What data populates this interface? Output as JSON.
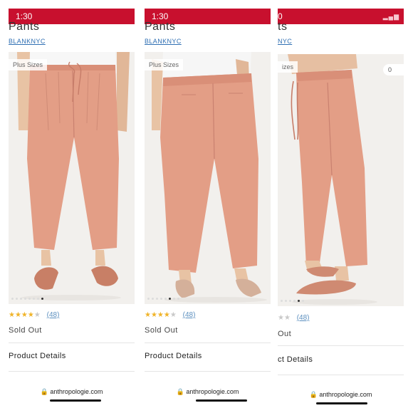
{
  "status_bar": {
    "time": "1:30",
    "time_partial": "0"
  },
  "product": {
    "title": "Pants",
    "title_partial": "ts",
    "brand": "BLANKNYC",
    "brand_partial": "NYC",
    "badge": "Plus Sizes",
    "badge_partial": "izes",
    "image_count_badge_partial": "0"
  },
  "rating": {
    "stars": 3.5,
    "max": 5,
    "count": "(48)"
  },
  "availability": {
    "label": "Sold Out",
    "label_partial": "Out"
  },
  "product_details": {
    "label": "Product Details",
    "label_partial": "ct Details"
  },
  "browser": {
    "url": "anthropologie.com",
    "lock_icon": "lock-icon"
  },
  "carousel": {
    "total": 8,
    "active_index": [
      7,
      5,
      6
    ]
  },
  "colors": {
    "status_bar": "#c8102e",
    "pants": "#e39e86",
    "link": "#2f6fb3",
    "stars": "#f0b429"
  }
}
